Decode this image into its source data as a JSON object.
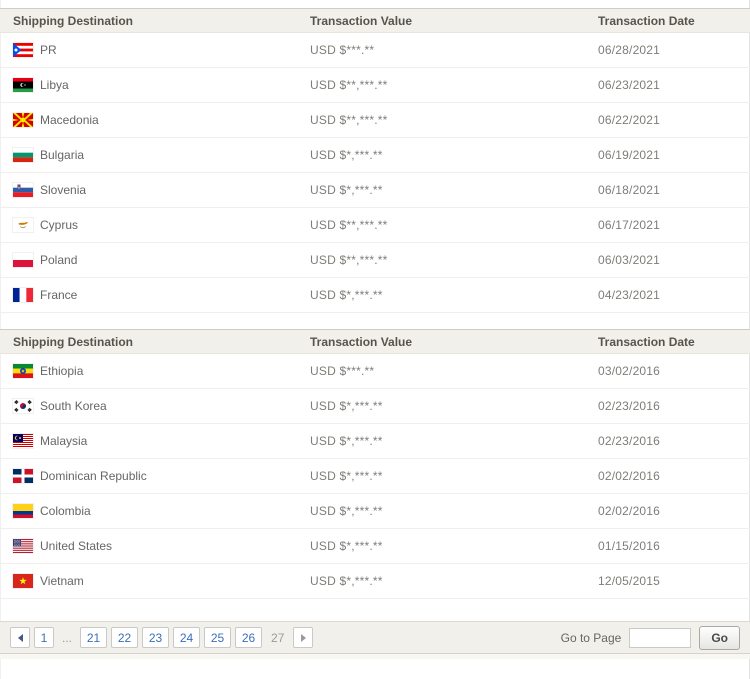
{
  "colors": {
    "header_bg": "#f1f0ea",
    "link_accent": "#3b6fb6",
    "row_text": "#666666",
    "muted_text": "#7d7d78"
  },
  "tables": [
    {
      "headers": {
        "destination": "Shipping Destination",
        "value": "Transaction Value",
        "date": "Transaction Date"
      },
      "rows": [
        {
          "country": "PR",
          "flag": "pr",
          "value": "USD $***.**",
          "date": "06/28/2021"
        },
        {
          "country": "Libya",
          "flag": "ly",
          "value": "USD $**,***.**",
          "date": "06/23/2021"
        },
        {
          "country": "Macedonia",
          "flag": "mk",
          "value": "USD $**,***.**",
          "date": "06/22/2021"
        },
        {
          "country": "Bulgaria",
          "flag": "bg",
          "value": "USD $*,***.**",
          "date": "06/19/2021"
        },
        {
          "country": "Slovenia",
          "flag": "si",
          "value": "USD $*,***.**",
          "date": "06/18/2021"
        },
        {
          "country": "Cyprus",
          "flag": "cy",
          "value": "USD $**,***.**",
          "date": "06/17/2021"
        },
        {
          "country": "Poland",
          "flag": "pl",
          "value": "USD $**,***.**",
          "date": "06/03/2021"
        },
        {
          "country": "France",
          "flag": "fr",
          "value": "USD $*,***.**",
          "date": "04/23/2021"
        }
      ]
    },
    {
      "headers": {
        "destination": "Shipping Destination",
        "value": "Transaction Value",
        "date": "Transaction Date"
      },
      "rows": [
        {
          "country": "Ethiopia",
          "flag": "et",
          "value": "USD $***.**",
          "date": "03/02/2016"
        },
        {
          "country": "South Korea",
          "flag": "kr",
          "value": "USD $*,***.**",
          "date": "02/23/2016"
        },
        {
          "country": "Malaysia",
          "flag": "my",
          "value": "USD $*,***.**",
          "date": "02/23/2016"
        },
        {
          "country": "Dominican Republic",
          "flag": "do",
          "value": "USD $*,***.**",
          "date": "02/02/2016"
        },
        {
          "country": "Colombia",
          "flag": "co",
          "value": "USD $*,***.**",
          "date": "02/02/2016"
        },
        {
          "country": "United States",
          "flag": "us",
          "value": "USD $*,***.**",
          "date": "01/15/2016"
        },
        {
          "country": "Vietnam",
          "flag": "vn",
          "value": "USD $*,***.**",
          "date": "12/05/2015"
        }
      ]
    }
  ],
  "pagination": {
    "prev_icon": "left-arrow",
    "next_icon": "right-arrow",
    "pages": [
      {
        "label": "1",
        "state": "link"
      },
      {
        "label": "...",
        "state": "ellipsis"
      },
      {
        "label": "21",
        "state": "link"
      },
      {
        "label": "22",
        "state": "link"
      },
      {
        "label": "23",
        "state": "link"
      },
      {
        "label": "24",
        "state": "link"
      },
      {
        "label": "25",
        "state": "link"
      },
      {
        "label": "26",
        "state": "link"
      },
      {
        "label": "27",
        "state": "current"
      }
    ],
    "goto_label": "Go to Page",
    "goto_input_value": "",
    "go_button_label": "Go"
  }
}
